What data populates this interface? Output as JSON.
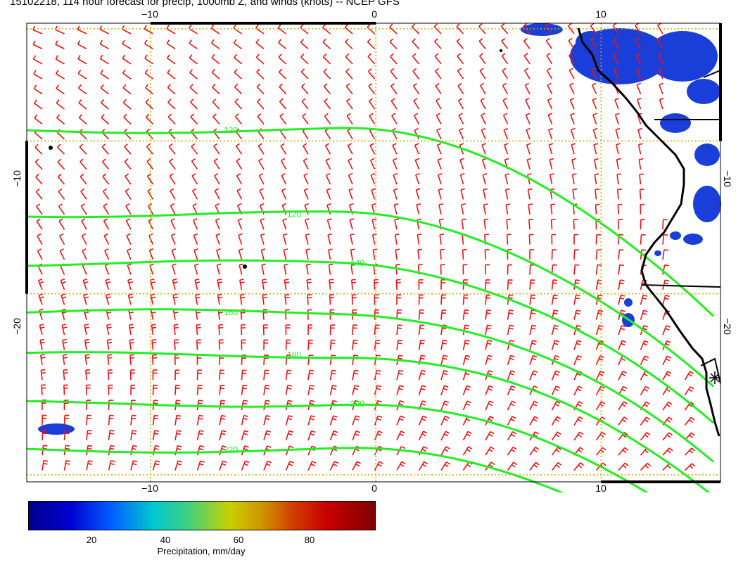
{
  "title": "15102218, 114 hour forecast for precip, 1000mb Z, and winds (knots) -- NCEP GFS",
  "axes": {
    "top": [
      {
        "text": "−10",
        "lon": -10
      },
      {
        "text": "0",
        "lon": 0
      },
      {
        "text": "10",
        "lon": 10
      }
    ],
    "bottom": [
      {
        "text": "−10",
        "lon": -10
      },
      {
        "text": "0",
        "lon": 0
      },
      {
        "text": "10",
        "lon": 10
      }
    ],
    "left": [
      {
        "text": "−10",
        "lat": -10
      },
      {
        "text": "−20",
        "lat": -20
      }
    ],
    "right": [
      {
        "text": "−10",
        "lat": -10
      },
      {
        "text": "−20",
        "lat": -20
      }
    ]
  },
  "extent": {
    "lon_min": -15.5,
    "lon_max": 15.3,
    "lat_max": -2.3,
    "lat_min": -32.3
  },
  "colors": {
    "contour": "#22ee22",
    "wind_barb": "#ee1111",
    "grid": "#c8a800",
    "coast": "#000000",
    "precip": "#1a3fd8"
  },
  "contours": [
    {
      "label": "120",
      "lat": -9.3
    },
    {
      "label": "120",
      "lat": -14.8
    },
    {
      "label": "140",
      "lat": -18.0
    },
    {
      "label": "160",
      "lat": -21.2
    },
    {
      "label": "180",
      "lat": -24.0
    },
    {
      "label": "200",
      "lat": -27.2
    },
    {
      "label": "220",
      "lat": -30.2
    }
  ],
  "colorbar": {
    "title": "Precipitation, mm/day",
    "ticks": [
      "20",
      "40",
      "60",
      "80"
    ]
  }
}
